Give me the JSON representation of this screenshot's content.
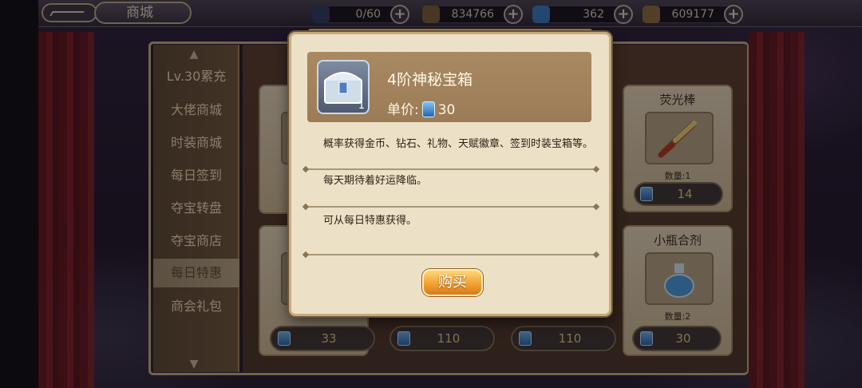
{
  "header": {
    "title": "商城",
    "resources": [
      {
        "icon": "energy-icon",
        "value": "0/60"
      },
      {
        "icon": "gold-coin-icon",
        "value": "834766"
      },
      {
        "icon": "diamond-ticket-icon",
        "value": "362"
      },
      {
        "icon": "leaf-token-icon",
        "value": "609177"
      }
    ]
  },
  "sidebar": {
    "items": [
      {
        "label": "Lv.30累充",
        "active": false
      },
      {
        "label": "大佬商城",
        "active": false
      },
      {
        "label": "时装商城",
        "active": false
      },
      {
        "label": "每日签到",
        "active": false
      },
      {
        "label": "夺宝转盘",
        "active": false
      },
      {
        "label": "夺宝商店",
        "active": false
      },
      {
        "label": "每日特惠",
        "active": true
      },
      {
        "label": "商会礼包",
        "active": false
      }
    ]
  },
  "cards": [
    {
      "name": "荧光棒",
      "qty": "数量:1",
      "price": "14"
    },
    {
      "name": "小瓶合剂",
      "qty": "数量:2",
      "price": "30"
    }
  ],
  "bottom_prices": [
    "33",
    "110",
    "110"
  ],
  "popup": {
    "item_name": "4阶神秘宝箱",
    "item_count": "1",
    "price_label": "单价:",
    "price_value": "30",
    "desc1": "概率获得金币、钻石、礼物、天赋徽章、签到时装宝箱等。",
    "desc2": "每天期待着好运降临。",
    "desc3": "可从每日特惠获得。",
    "buy_label": "购买"
  }
}
